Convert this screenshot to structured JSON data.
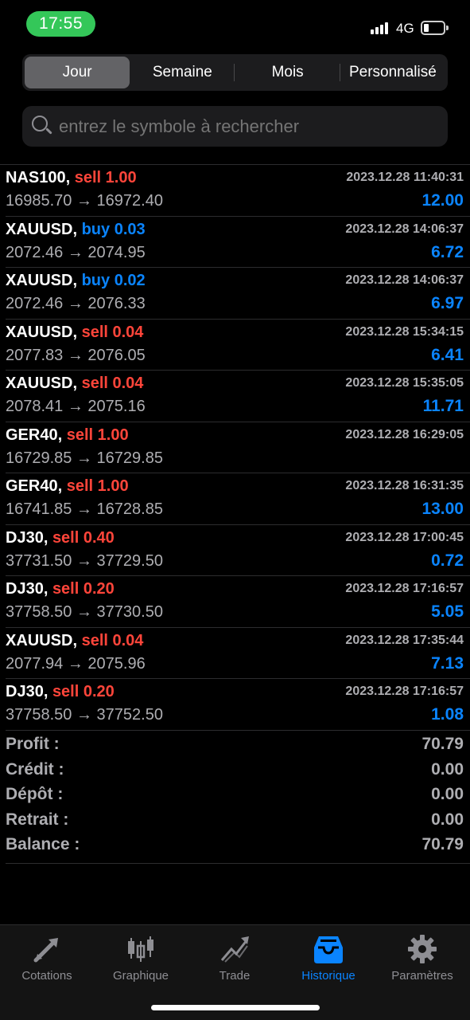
{
  "status": {
    "time": "17:55",
    "network": "4G"
  },
  "segments": [
    {
      "label": "Jour",
      "active": true
    },
    {
      "label": "Semaine",
      "active": false
    },
    {
      "label": "Mois",
      "active": false
    },
    {
      "label": "Personnalisé",
      "active": false
    }
  ],
  "search": {
    "placeholder": "entrez le symbole à rechercher"
  },
  "trades": [
    {
      "symbol": "NAS100,",
      "side": "sell 1.00",
      "prices": "16985.70 → 16972.40",
      "date": "2023.12.28 11:40:31",
      "profit": "12.00"
    },
    {
      "symbol": "XAUUSD,",
      "side": "buy 0.03",
      "prices": "2072.46 → 2074.95",
      "date": "2023.12.28 14:06:37",
      "profit": "6.72"
    },
    {
      "symbol": "XAUUSD,",
      "side": "buy 0.02",
      "prices": "2072.46 → 2076.33",
      "date": "2023.12.28 14:06:37",
      "profit": "6.97"
    },
    {
      "symbol": "XAUUSD,",
      "side": "sell 0.04",
      "prices": "2077.83 → 2076.05",
      "date": "2023.12.28 15:34:15",
      "profit": "6.41"
    },
    {
      "symbol": "XAUUSD,",
      "side": "sell 0.04",
      "prices": "2078.41 → 2075.16",
      "date": "2023.12.28 15:35:05",
      "profit": "11.71"
    },
    {
      "symbol": "GER40,",
      "side": "sell 1.00",
      "prices": "16729.85 → 16729.85",
      "date": "2023.12.28 16:29:05",
      "profit": ""
    },
    {
      "symbol": "GER40,",
      "side": "sell 1.00",
      "prices": "16741.85 → 16728.85",
      "date": "2023.12.28 16:31:35",
      "profit": "13.00"
    },
    {
      "symbol": "DJ30,",
      "side": "sell 0.40",
      "prices": "37731.50 → 37729.50",
      "date": "2023.12.28 17:00:45",
      "profit": "0.72"
    },
    {
      "symbol": "DJ30,",
      "side": "sell 0.20",
      "prices": "37758.50 → 37730.50",
      "date": "2023.12.28 17:16:57",
      "profit": "5.05"
    },
    {
      "symbol": "XAUUSD,",
      "side": "sell 0.04",
      "prices": "2077.94 → 2075.96",
      "date": "2023.12.28 17:35:44",
      "profit": "7.13"
    },
    {
      "symbol": "DJ30,",
      "side": "sell 0.20",
      "prices": "37758.50 → 37752.50",
      "date": "2023.12.28 17:16:57",
      "profit": "1.08"
    }
  ],
  "summary": [
    {
      "label": "Profit :",
      "value": "70.79"
    },
    {
      "label": "Crédit :",
      "value": "0.00"
    },
    {
      "label": "Dépôt :",
      "value": "0.00"
    },
    {
      "label": "Retrait :",
      "value": "0.00"
    },
    {
      "label": "Balance :",
      "value": "70.79"
    }
  ],
  "tabs": [
    {
      "label": "Cotations",
      "icon": "quotes-arrows-icon",
      "active": false
    },
    {
      "label": "Graphique",
      "icon": "candlestick-chart-icon",
      "active": false
    },
    {
      "label": "Trade",
      "icon": "trade-trend-icon",
      "active": false
    },
    {
      "label": "Historique",
      "icon": "history-tray-icon",
      "active": true
    },
    {
      "label": "Paramètres",
      "icon": "gear-icon",
      "active": false
    }
  ],
  "colors": {
    "sell": "#ff453a",
    "buy": "#0a84ff",
    "accent": "#0a84ff",
    "status_pill": "#34c759"
  }
}
